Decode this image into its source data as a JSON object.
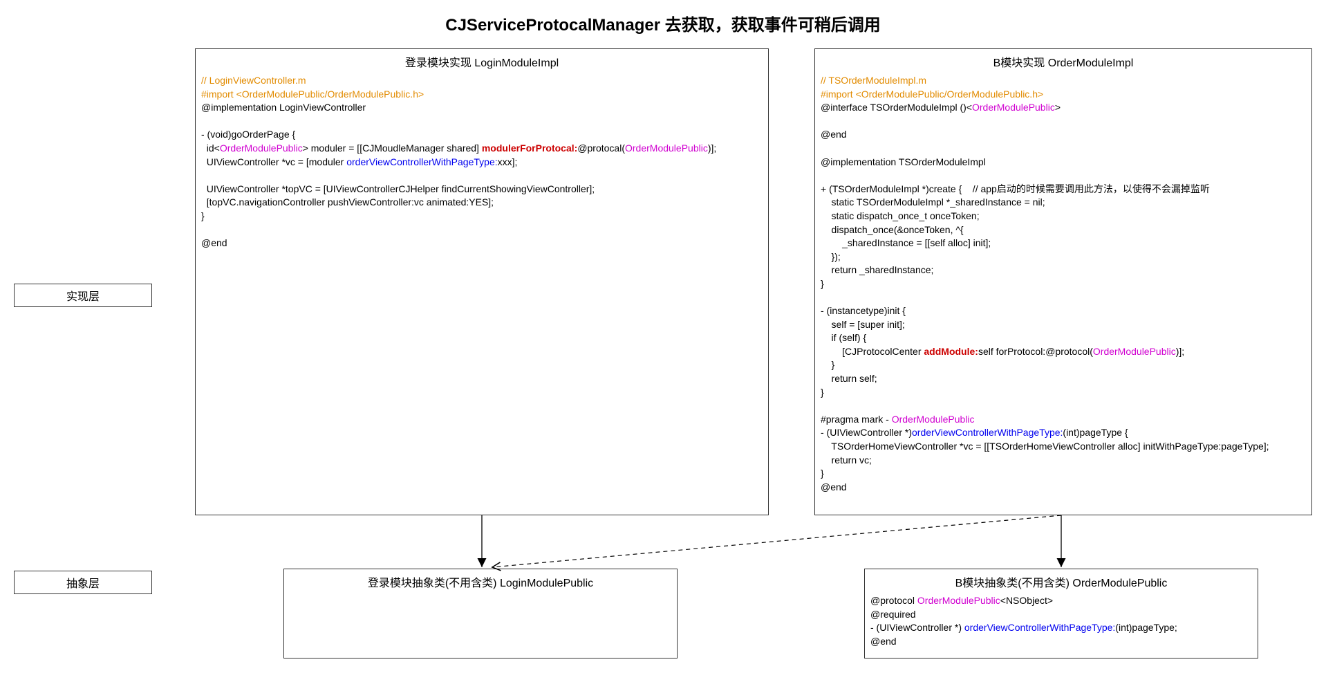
{
  "title": "CJServiceProtocalManager 去获取，获取事件可稍后调用",
  "layers": {
    "impl": "实现层",
    "abstract": "抽象层"
  },
  "boxes": {
    "login_impl": {
      "title": "登录模块实现 LoginModuleImpl",
      "line1": "// LoginViewController.m",
      "line2": "#import <OrderModulePublic/OrderModulePublic.h>",
      "line3": "@implementation LoginViewController",
      "line4": "- (void)goOrderPage {",
      "line5a": "  id<",
      "line5b": "OrderModulePublic",
      "line5c": "> moduler = [[CJMoudleManager shared] ",
      "line5d": "modulerForProtocal:",
      "line5e": "@protocal(",
      "line5f": "OrderModulePublic",
      "line5g": ")];",
      "line6a": "  UIViewController *vc = [moduler ",
      "line6b": "orderViewControllerWithPageType:",
      "line6c": "xxx];",
      "line7": "  UIViewController *topVC = [UIViewControllerCJHelper findCurrentShowingViewController];",
      "line8": "  [topVC.navigationController pushViewController:vc animated:YES];",
      "line9": "}",
      "line10": "@end"
    },
    "order_impl": {
      "title": "B模块实现 OrderModuleImpl",
      "line1": "// TSOrderModuleImpl.m",
      "line2": "#import <OrderModulePublic/OrderModulePublic.h>",
      "line3a": "@interface TSOrderModuleImpl ()<",
      "line3b": "OrderModulePublic",
      "line3c": ">",
      "line4": "@end",
      "line5": "@implementation TSOrderModuleImpl",
      "line6": "+ (TSOrderModuleImpl *)create {    // app启动的时候需要调用此方法，以使得不会漏掉监听",
      "line7": "    static TSOrderModuleImpl *_sharedInstance = nil;",
      "line8": "    static dispatch_once_t onceToken;",
      "line9": "    dispatch_once(&onceToken, ^{",
      "line10": "        _sharedInstance = [[self alloc] init];",
      "line11": "    });",
      "line12": "    return _sharedInstance;",
      "line13": "}",
      "line14": "- (instancetype)init {",
      "line15": "    self = [super init];",
      "line16": "    if (self) {",
      "line17a": "        [CJProtocolCenter ",
      "line17b": "addModule:",
      "line17c": "self forProtocol:@protocol(",
      "line17d": "OrderModulePublic",
      "line17e": ")];",
      "line18": "    }",
      "line19": "    return self;",
      "line20": "}",
      "line21a": "#pragma mark - ",
      "line21b": "OrderModulePublic",
      "line22a": "- (UIViewController *)",
      "line22b": "orderViewControllerWithPageType:",
      "line22c": "(int)pageType {",
      "line23": "    TSOrderHomeViewController *vc = [[TSOrderHomeViewController alloc] initWithPageType:pageType];",
      "line24": "    return vc;",
      "line25": "}",
      "line26": "@end"
    },
    "login_pub": {
      "title": "登录模块抽象类(不用含类) LoginModulePublic"
    },
    "order_pub": {
      "title": "B模块抽象类(不用含类) OrderModulePublic",
      "line1a": "@protocol ",
      "line1b": "OrderModulePublic",
      "line1c": "<NSObject>",
      "line2": "@required",
      "line3a": "- (UIViewController *) ",
      "line3b": "orderViewControllerWithPageType:",
      "line3c": "(int)pageType;",
      "line4": "@end"
    }
  }
}
